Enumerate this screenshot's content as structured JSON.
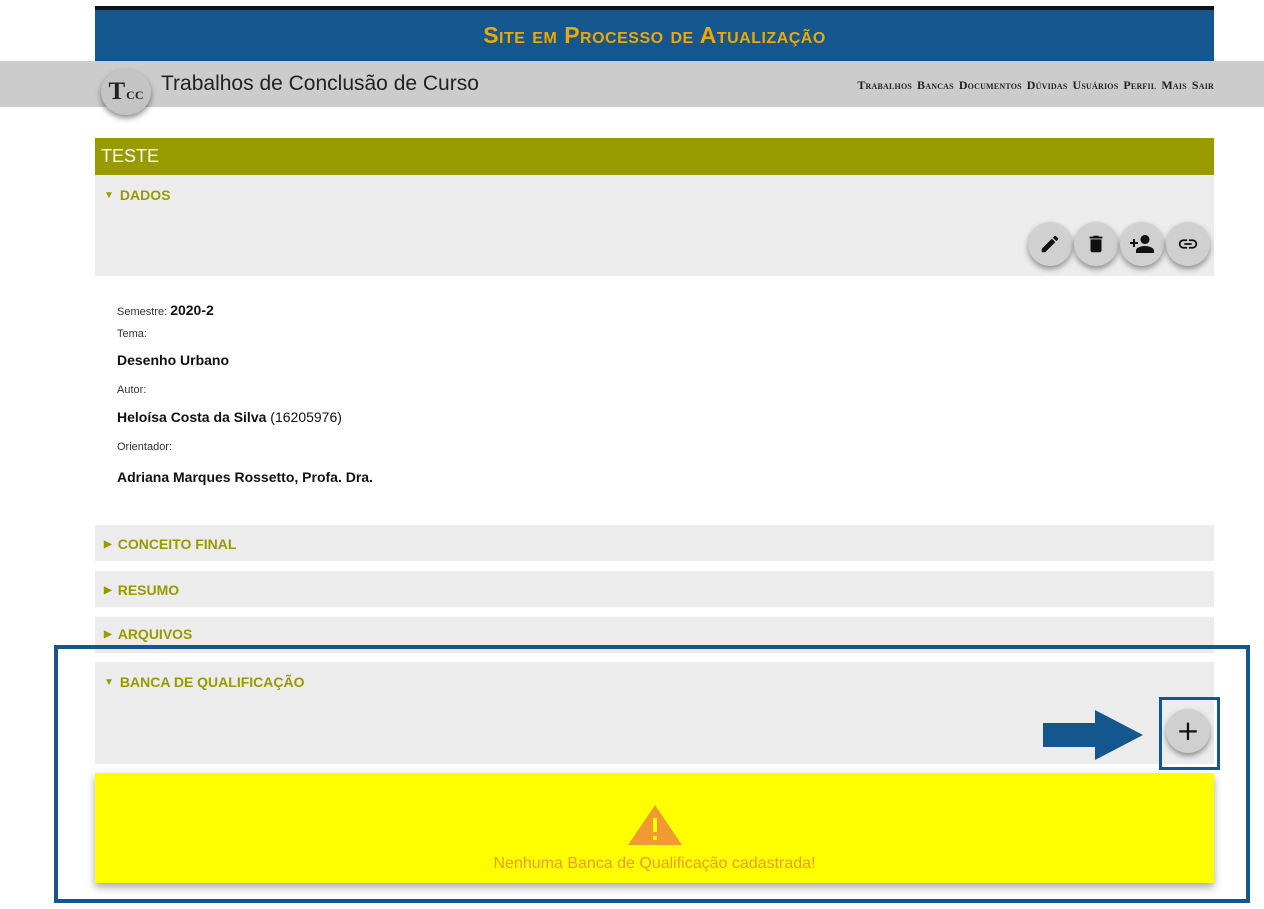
{
  "banner": {
    "text": "Site em Processo de Atualização"
  },
  "header": {
    "logo_big": "T",
    "logo_small": "cc",
    "title": "Trabalhos de Conclusão de Curso",
    "nav": [
      "Trabalhos",
      "Bancas",
      "Documentos",
      "Dúvidas",
      "Usuários",
      "Perfil",
      "Mais",
      "Sair"
    ]
  },
  "work": {
    "title": "TESTE",
    "sections": {
      "dados": "DADOS",
      "conceito_final": "CONCEITO FINAL",
      "resumo": "RESUMO",
      "arquivos": "ARQUIVOS",
      "banca": "BANCA DE QUALIFICAÇÃO"
    },
    "semestre_label": "Semestre:",
    "semestre_value": "2020-2",
    "tema_label": "Tema:",
    "tema_value": "Desenho Urbano",
    "autor_label": "Autor:",
    "autor_name": "Heloísa Costa da Silva",
    "autor_id": "(16205976)",
    "orientador_label": "Orientador:",
    "orientador_value": "Adriana Marques Rossetto, Profa. Dra."
  },
  "actions": [
    "edit-icon",
    "delete-icon",
    "add-person-icon",
    "link-icon"
  ],
  "banca": {
    "add_button": "+",
    "empty_message": "Nenhuma Banca de Qualificação cadastrada!"
  },
  "colors": {
    "banner_bg": "#14568e",
    "banner_text": "#f0a800",
    "accent_olive": "#999900",
    "warning_bg": "#ffff00",
    "warning_text": "#f09a34",
    "highlight": "#14568e"
  }
}
